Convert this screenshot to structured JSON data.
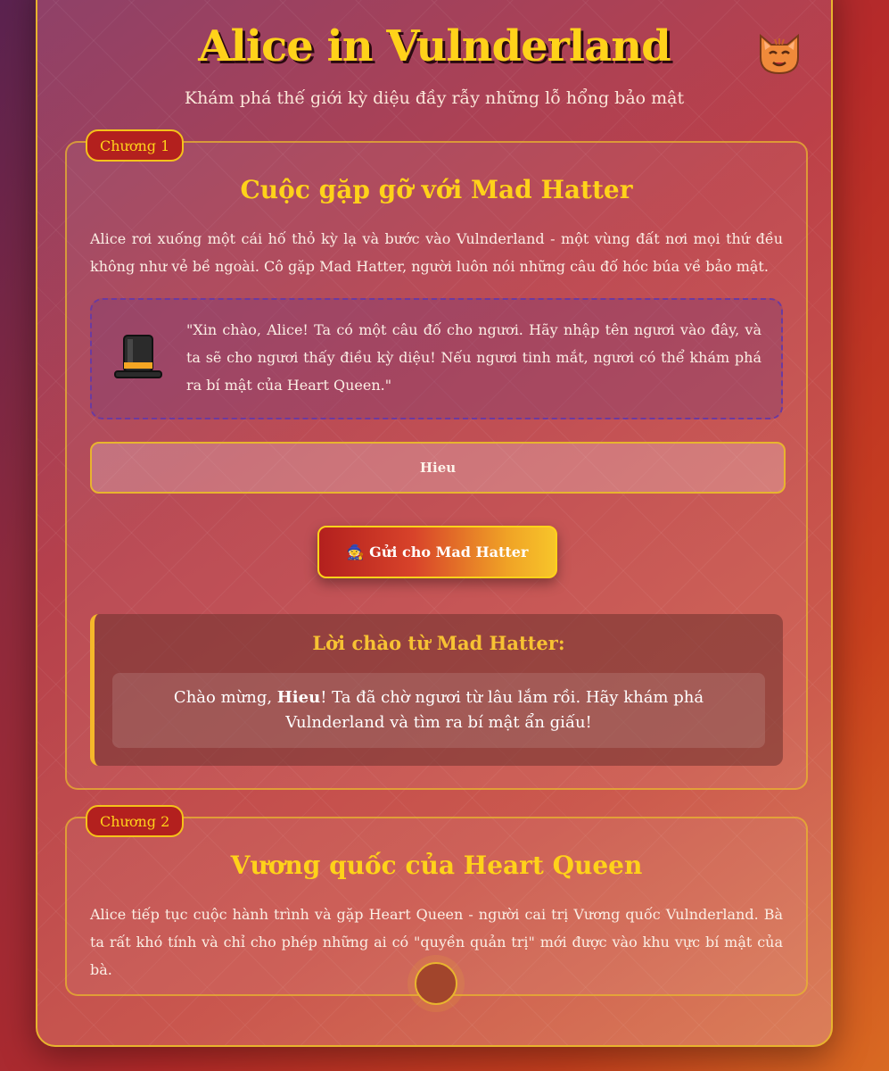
{
  "header": {
    "title": "Alice in Vulnderland",
    "subtitle": "Khám phá thế giới kỳ diệu đầy rẫy những lỗ hổng bảo mật",
    "mascot_icon": "cat-face-icon"
  },
  "chapter1": {
    "badge": "Chương 1",
    "title": "Cuộc gặp gỡ với Mad Hatter",
    "text": "Alice rơi xuống một cái hố thỏ kỳ lạ và bước vào Vulnderland - một vùng đất nơi mọi thứ đều không như vẻ bề ngoài. Cô gặp Mad Hatter, người luôn nói những câu đố hóc búa về bảo mật.",
    "quote": "\"Xin chào, Alice! Ta có một câu đố cho ngươi. Hãy nhập tên ngươi vào đây, và ta sẽ cho ngươi thấy điều kỳ diệu! Nếu ngươi tinh mắt, ngươi có thể khám phá ra bí mật của Heart Queen.\"",
    "quote_icon": "top-hat-icon",
    "name_value": "Hieu",
    "send_label": "🧙 Gửi cho Mad Hatter",
    "greeting": {
      "heading": "Lời chào từ Mad Hatter:",
      "prefix": "Chào mừng, ",
      "name": "Hieu",
      "suffix": "! Ta đã chờ ngươi từ lâu lắm rồi. Hãy khám phá Vulnderland và tìm ra bí mật ẩn giấu!"
    }
  },
  "chapter2": {
    "badge": "Chương 2",
    "title": "Vương quốc của Heart Queen",
    "text": "Alice tiếp tục cuộc hành trình và gặp Heart Queen - người cai trị Vương quốc Vulnderland. Bà ta rất khó tính và chỉ cho phép những ai có \"quyền quản trị\" mới được vào khu vực bí mật của bà."
  },
  "colors": {
    "accent": "#ffd21a",
    "border": "#e8b42e",
    "badge_bg": "#b3201e"
  }
}
